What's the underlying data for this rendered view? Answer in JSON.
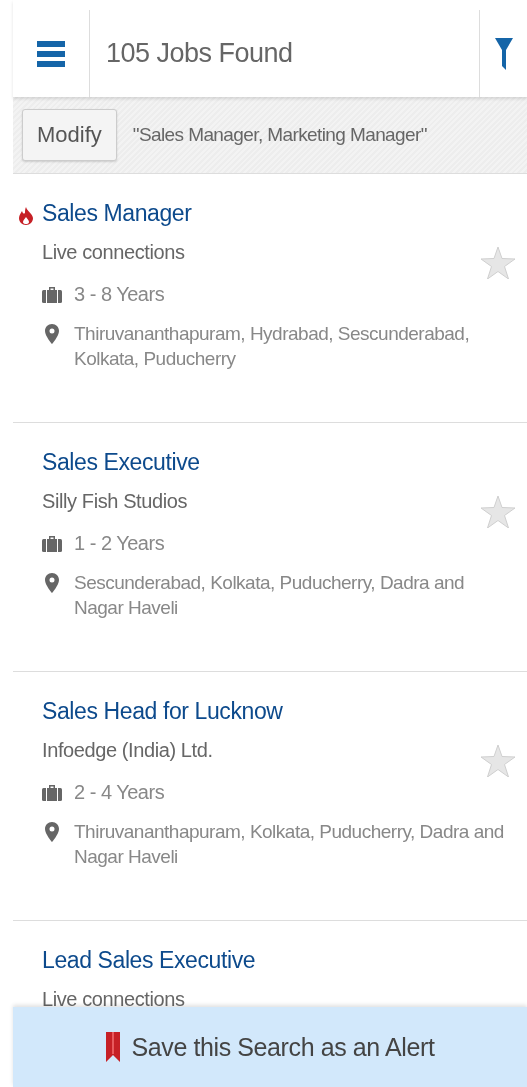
{
  "header": {
    "title": "105 Jobs Found"
  },
  "search_bar": {
    "button": "Modify",
    "query": "\"Sales Manager, Marketing Manager\""
  },
  "jobs": [
    {
      "title": "Sales Manager",
      "hot": true,
      "company": "Live connections",
      "experience": "3 - 8 Years",
      "locations": "Thiruvananthapuram, Hydrabad, Sescunderabad, Kolkata, Puducherry",
      "starred": false
    },
    {
      "title": "Sales Executive",
      "hot": false,
      "company": "Silly Fish Studios",
      "experience": "1 - 2 Years",
      "locations": "Sescunderabad, Kolkata, Puducherry, Dadra and Nagar Haveli",
      "starred": false
    },
    {
      "title": "Sales Head for Lucknow",
      "hot": false,
      "company": "Infoedge (India) Ltd.",
      "experience": "2 - 4 Years",
      "locations": "Thiruvananthapuram, Kolkata, Puducherry, Dadra and Nagar Haveli",
      "starred": false
    },
    {
      "title": "Lead Sales Executive",
      "hot": false,
      "company": "Live connections"
    }
  ],
  "save_alert": {
    "label": "Save this Search as an Alert"
  }
}
